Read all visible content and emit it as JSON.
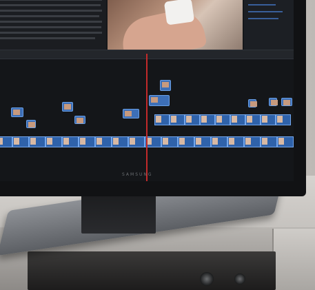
{
  "scene": {
    "description": "",
    "monitor_brand": "SAMSUNG"
  },
  "screen": {
    "app": "",
    "playhead_color": "#c42a2a",
    "clip_color": "#3d6fb7",
    "accent": "#6aa0e6"
  },
  "icons": [
    "play-icon",
    "playhead-marker"
  ]
}
